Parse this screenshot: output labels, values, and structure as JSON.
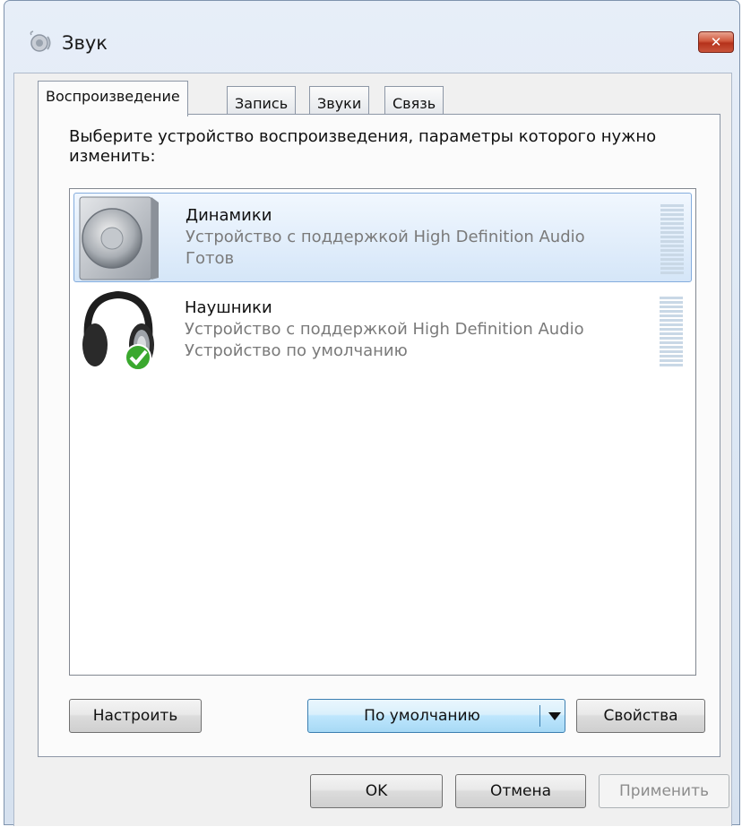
{
  "window": {
    "title": "Звук",
    "close_symbol": "✕"
  },
  "tabs": [
    {
      "label": "Воспроизведение",
      "active": true
    },
    {
      "label": "Запись",
      "active": false
    },
    {
      "label": "Звуки",
      "active": false
    },
    {
      "label": "Связь",
      "active": false
    }
  ],
  "playback": {
    "instruction": "Выберите устройство воспроизведения, параметры которого нужно изменить:",
    "devices": [
      {
        "name": "Динамики",
        "description": "Устройство с поддержкой High Definition Audio",
        "status": "Готов",
        "icon": "speaker-icon",
        "selected": true
      },
      {
        "name": "Наушники",
        "description": "Устройство с поддержкой High Definition Audio",
        "status": "Устройство по умолчанию",
        "icon": "headphones-icon",
        "default_badge": "checkmark-icon",
        "selected": false
      }
    ],
    "configure_label": "Настроить",
    "set_default_label": "По умолчанию",
    "properties_label": "Свойства"
  },
  "footer": {
    "ok_label": "OK",
    "cancel_label": "Отмена",
    "apply_label": "Применить"
  },
  "colors": {
    "selection": "#d5e6f8",
    "close_button": "#c9543b",
    "default_check": "#3aa82e"
  }
}
